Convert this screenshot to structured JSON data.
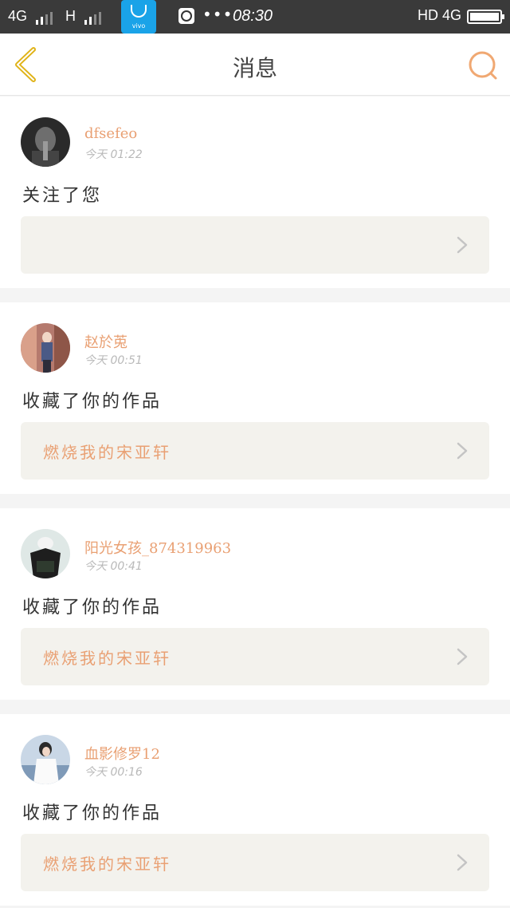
{
  "status_bar": {
    "network_left": "4G",
    "network_h": "H",
    "vivo_label": "vivo",
    "dots": "•••",
    "time": "08:30",
    "network_right": "HD 4G"
  },
  "header": {
    "title": "消息"
  },
  "messages": [
    {
      "user": "dfsefeo",
      "time": "今天  01:22",
      "action": "关注了您",
      "work": ""
    },
    {
      "user": "赵於莵",
      "time": "今天  00:51",
      "action": "收藏了你的作品",
      "work": "燃烧我的宋亚轩"
    },
    {
      "user": "阳光女孩_874319963",
      "time": "今天  00:41",
      "action": "收藏了你的作品",
      "work": "燃烧我的宋亚轩"
    },
    {
      "user": "血影修罗12",
      "time": "今天  00:16",
      "action": "收藏了你的作品",
      "work": "燃烧我的宋亚轩"
    }
  ],
  "colors": {
    "accent": "#e9a073",
    "back_icon": "#e0b318"
  },
  "icons": {
    "back": "chevron-left-icon",
    "search": "search-icon",
    "work_arrow": "chevron-right-icon"
  }
}
